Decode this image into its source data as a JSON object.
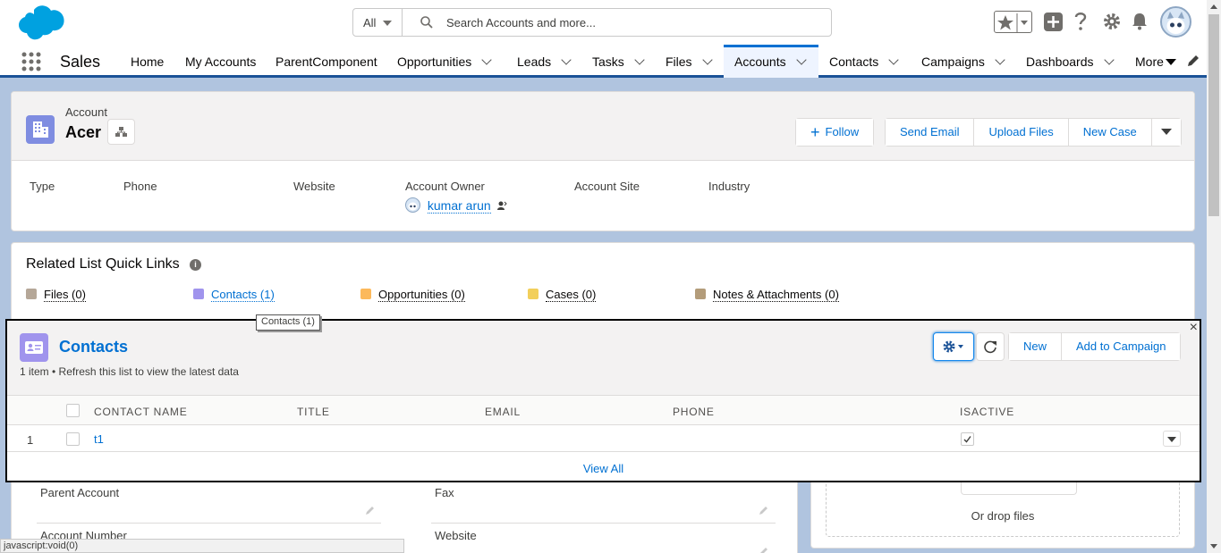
{
  "global_search": {
    "scope": "All",
    "placeholder": "Search Accounts and more..."
  },
  "nav": {
    "app_name": "Sales",
    "items": [
      {
        "label": "Home",
        "dropdown": false
      },
      {
        "label": "My Accounts",
        "dropdown": false
      },
      {
        "label": "ParentComponent",
        "dropdown": false
      },
      {
        "label": "Opportunities",
        "dropdown": true
      },
      {
        "label": "Leads",
        "dropdown": true
      },
      {
        "label": "Tasks",
        "dropdown": true
      },
      {
        "label": "Files",
        "dropdown": true
      },
      {
        "label": "Accounts",
        "dropdown": true,
        "active": true
      },
      {
        "label": "Contacts",
        "dropdown": true
      },
      {
        "label": "Campaigns",
        "dropdown": true
      },
      {
        "label": "Dashboards",
        "dropdown": true
      },
      {
        "label": "More",
        "dropdown": true
      }
    ]
  },
  "record": {
    "object_label": "Account",
    "name": "Acer",
    "actions": [
      "Follow",
      "Send Email",
      "Upload Files",
      "New Case"
    ],
    "fields": [
      "Type",
      "Phone",
      "Website",
      "Account Owner",
      "Account Site",
      "Industry"
    ],
    "owner_name": "kumar arun"
  },
  "quick_links": {
    "title": "Related List Quick Links",
    "items": [
      {
        "label": "Files (0)",
        "color": "#b5a798"
      },
      {
        "label": "Contacts (1)",
        "color": "#a094ed",
        "link": true
      },
      {
        "label": "Opportunities (0)",
        "color": "#fcb95b"
      },
      {
        "label": "Cases (0)",
        "color": "#f2cf5b"
      },
      {
        "label": "Notes & Attachments (0)",
        "color": "#b39c7a"
      }
    ],
    "tooltip": "Contacts (1)"
  },
  "contacts_panel": {
    "close": "×",
    "title": "Contacts",
    "subtitle": "1 item • Refresh this list to view the latest data",
    "buttons": [
      "New",
      "Add to Campaign"
    ],
    "columns": [
      "CONTACT NAME",
      "TITLE",
      "EMAIL",
      "PHONE",
      "ISACTIVE"
    ],
    "rows": [
      {
        "num": "1",
        "name": "t1",
        "isactive": true
      }
    ],
    "view_all": "View All"
  },
  "details": {
    "left_fields": [
      "Parent Account",
      "Account Number"
    ],
    "right_fields": [
      "Fax",
      "Website"
    ]
  },
  "files": {
    "drop_text": "Or drop files"
  },
  "status_bar": "javascript:void(0)",
  "colors": {
    "brand": "#0070d2",
    "nav_active": "#0070d2",
    "account_icon": "#7f8de1",
    "contact_icon": "#a094ed"
  }
}
